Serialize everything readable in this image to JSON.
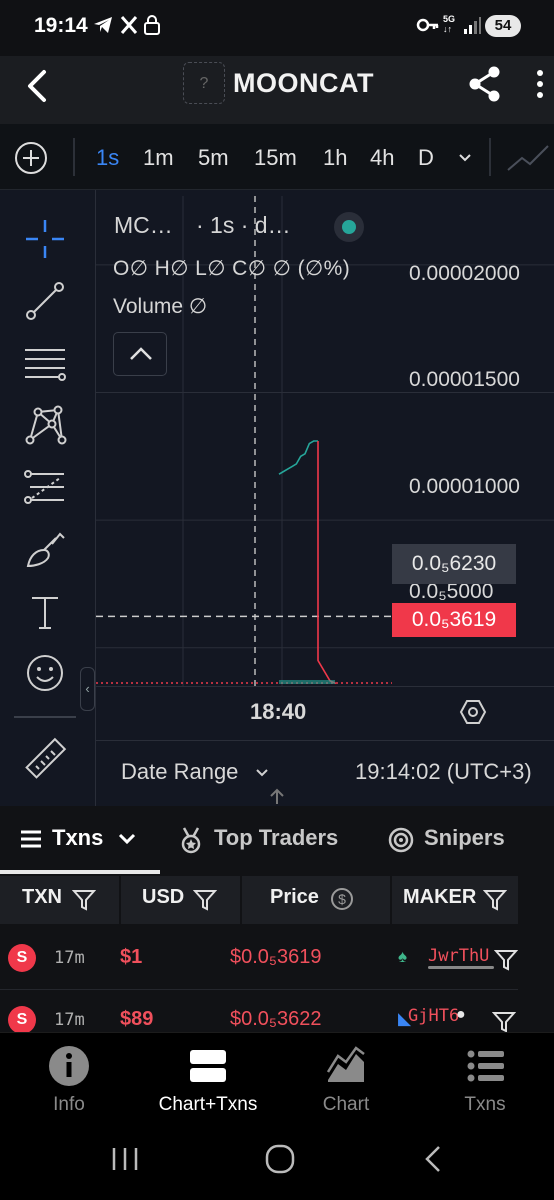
{
  "status_bar": {
    "time": "19:14",
    "battery": "54",
    "network": "5G"
  },
  "header": {
    "title": "MOONCAT",
    "token_icon": "?"
  },
  "timeframes": {
    "items": [
      "1s",
      "1m",
      "5m",
      "15m",
      "1h",
      "4h",
      "D"
    ],
    "selected": "1s"
  },
  "chart": {
    "legend_symbol": "MC…",
    "legend_interval": "· 1s · d…",
    "legend_ohlc": "O∅ H∅ L∅ C∅ ∅ (∅%)",
    "legend_volume": "Volume ∅",
    "y_ticks": [
      "0.00002000",
      "0.00001500",
      "0.00001000",
      "0.0₅5000"
    ],
    "cursor_price": "0.0₅6230",
    "last_price": "0.0₅3619",
    "time_label": "18:40",
    "date_range_label": "Date Range",
    "timestamp": "19:14:02 (UTC+3)",
    "colors": {
      "up": "#26a69a",
      "down": "#f0384a",
      "bg": "#131722"
    }
  },
  "chart_data": {
    "type": "line",
    "title": "",
    "xlabel": "",
    "ylabel": "",
    "x_ticks": [
      "18:40"
    ],
    "y_ticks": [
      5e-06,
      1e-05,
      1.5e-05,
      2e-05
    ],
    "ylim": [
      3.5e-06,
      2.27e-05
    ],
    "series": [
      {
        "color": "#26a69a",
        "values": [
          1.18e-05,
          1.19e-05,
          1.2e-05,
          1.21e-05,
          1.22e-05,
          1.25e-05,
          1.26e-05,
          1.3e-05,
          1.31e-05,
          1.31e-05
        ]
      },
      {
        "color": "#f0384a",
        "values": [
          1.31e-05,
          4.5e-06,
          3.7e-06,
          3.6e-06
        ]
      }
    ],
    "reference_lines": [
      {
        "value": 6.23e-06,
        "style": "dashed",
        "color": "#cccccc"
      },
      {
        "value": 3.619e-06,
        "style": "dotted",
        "color": "#f0384a"
      }
    ],
    "grid": true
  },
  "txns": {
    "tabs": [
      "Txns",
      "Top Traders",
      "Snipers"
    ],
    "columns": [
      "TXN",
      "USD",
      "Price",
      "MAKER"
    ],
    "rows": [
      {
        "type": "S",
        "age": "17m",
        "usd": "$1",
        "price": "$0.0₅3619",
        "maker": "JwrThU"
      },
      {
        "type": "S",
        "age": "17m",
        "usd": "$89",
        "price": "$0.0₅3622",
        "maker": "GjHT6"
      }
    ]
  },
  "bottom_nav": {
    "items": [
      "Info",
      "Chart+Txns",
      "Chart",
      "Txns"
    ],
    "active": "Chart+Txns"
  }
}
